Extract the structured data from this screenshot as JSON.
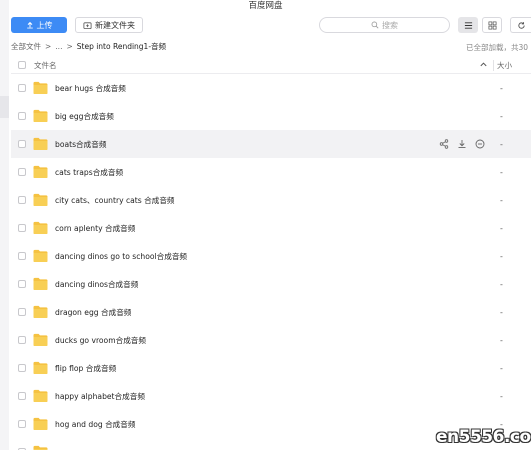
{
  "window": {
    "title": "百度网盘"
  },
  "toolbar": {
    "upload_label": "上传",
    "new_folder_label": "新建文件夹",
    "search_placeholder": "搜索"
  },
  "breadcrumb": {
    "items": [
      "全部文件",
      ">",
      "...",
      ">",
      "Step into Rending1-音频"
    ],
    "loaded_status": "已全部加载，共30"
  },
  "table": {
    "col_name": "文件名",
    "col_size": "大小"
  },
  "files": [
    {
      "name": "bear hugs 合成音频",
      "size": "-"
    },
    {
      "name": "big egg合成音频",
      "size": "-"
    },
    {
      "name": "boats合成音频",
      "size": "-"
    },
    {
      "name": "cats traps合成音频",
      "size": "-"
    },
    {
      "name": "city cats、country cats 合成音频",
      "size": "-"
    },
    {
      "name": "corn aplenty 合成音频",
      "size": "-"
    },
    {
      "name": "dancing dinos go to school合成音频",
      "size": "-"
    },
    {
      "name": "dancing dinos合成音频",
      "size": "-"
    },
    {
      "name": "dragon egg 合成音频",
      "size": "-"
    },
    {
      "name": "ducks go vroom合成音频",
      "size": "-"
    },
    {
      "name": "flip flop 合成音频",
      "size": "-"
    },
    {
      "name": "happy alphabet合成音频",
      "size": "-"
    },
    {
      "name": "hog and dog 合成音频",
      "size": "-"
    },
    {
      "name": "",
      "size": ""
    }
  ],
  "hovered_row_index": 2,
  "watermark": "en5556.com",
  "colors": {
    "accent": "#3d8bf5",
    "folder": "#f5c242",
    "hover": "#f2f2f4"
  }
}
